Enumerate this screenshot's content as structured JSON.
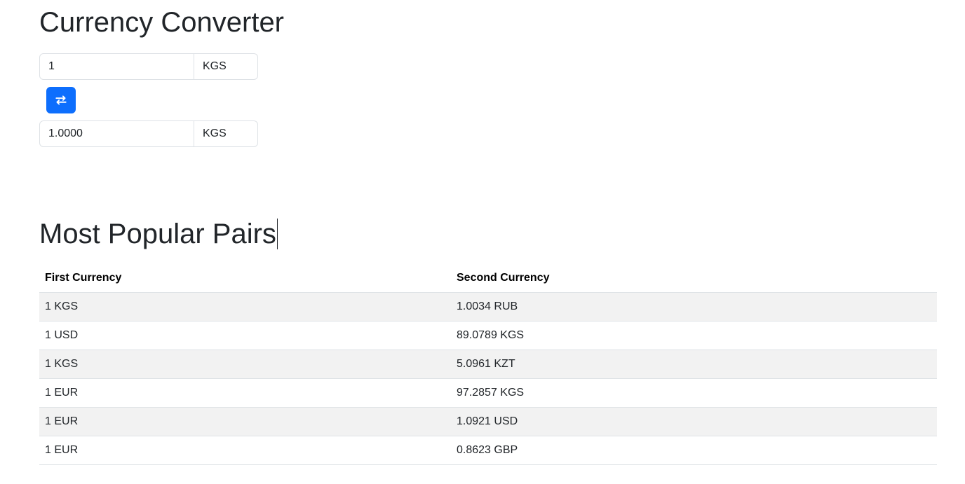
{
  "converter": {
    "title": "Currency Converter",
    "from": {
      "amount": "1",
      "currency": "KGS"
    },
    "to": {
      "amount": "1.0000",
      "currency": "KGS"
    },
    "swap_icon": "swap-arrows-icon"
  },
  "popular": {
    "title": "Most Popular Pairs",
    "columns": [
      "First Currency",
      "Second Currency"
    ],
    "rows": [
      [
        "1 KGS",
        "1.0034 RUB"
      ],
      [
        "1 USD",
        "89.0789 KGS"
      ],
      [
        "1 KGS",
        "5.0961 KZT"
      ],
      [
        "1 EUR",
        "97.2857 KGS"
      ],
      [
        "1 EUR",
        "1.0921 USD"
      ],
      [
        "1 EUR",
        "0.8623 GBP"
      ]
    ]
  },
  "colors": {
    "accent": "#0d6efd",
    "stripe": "#f2f2f2",
    "border": "#dee2e6"
  }
}
